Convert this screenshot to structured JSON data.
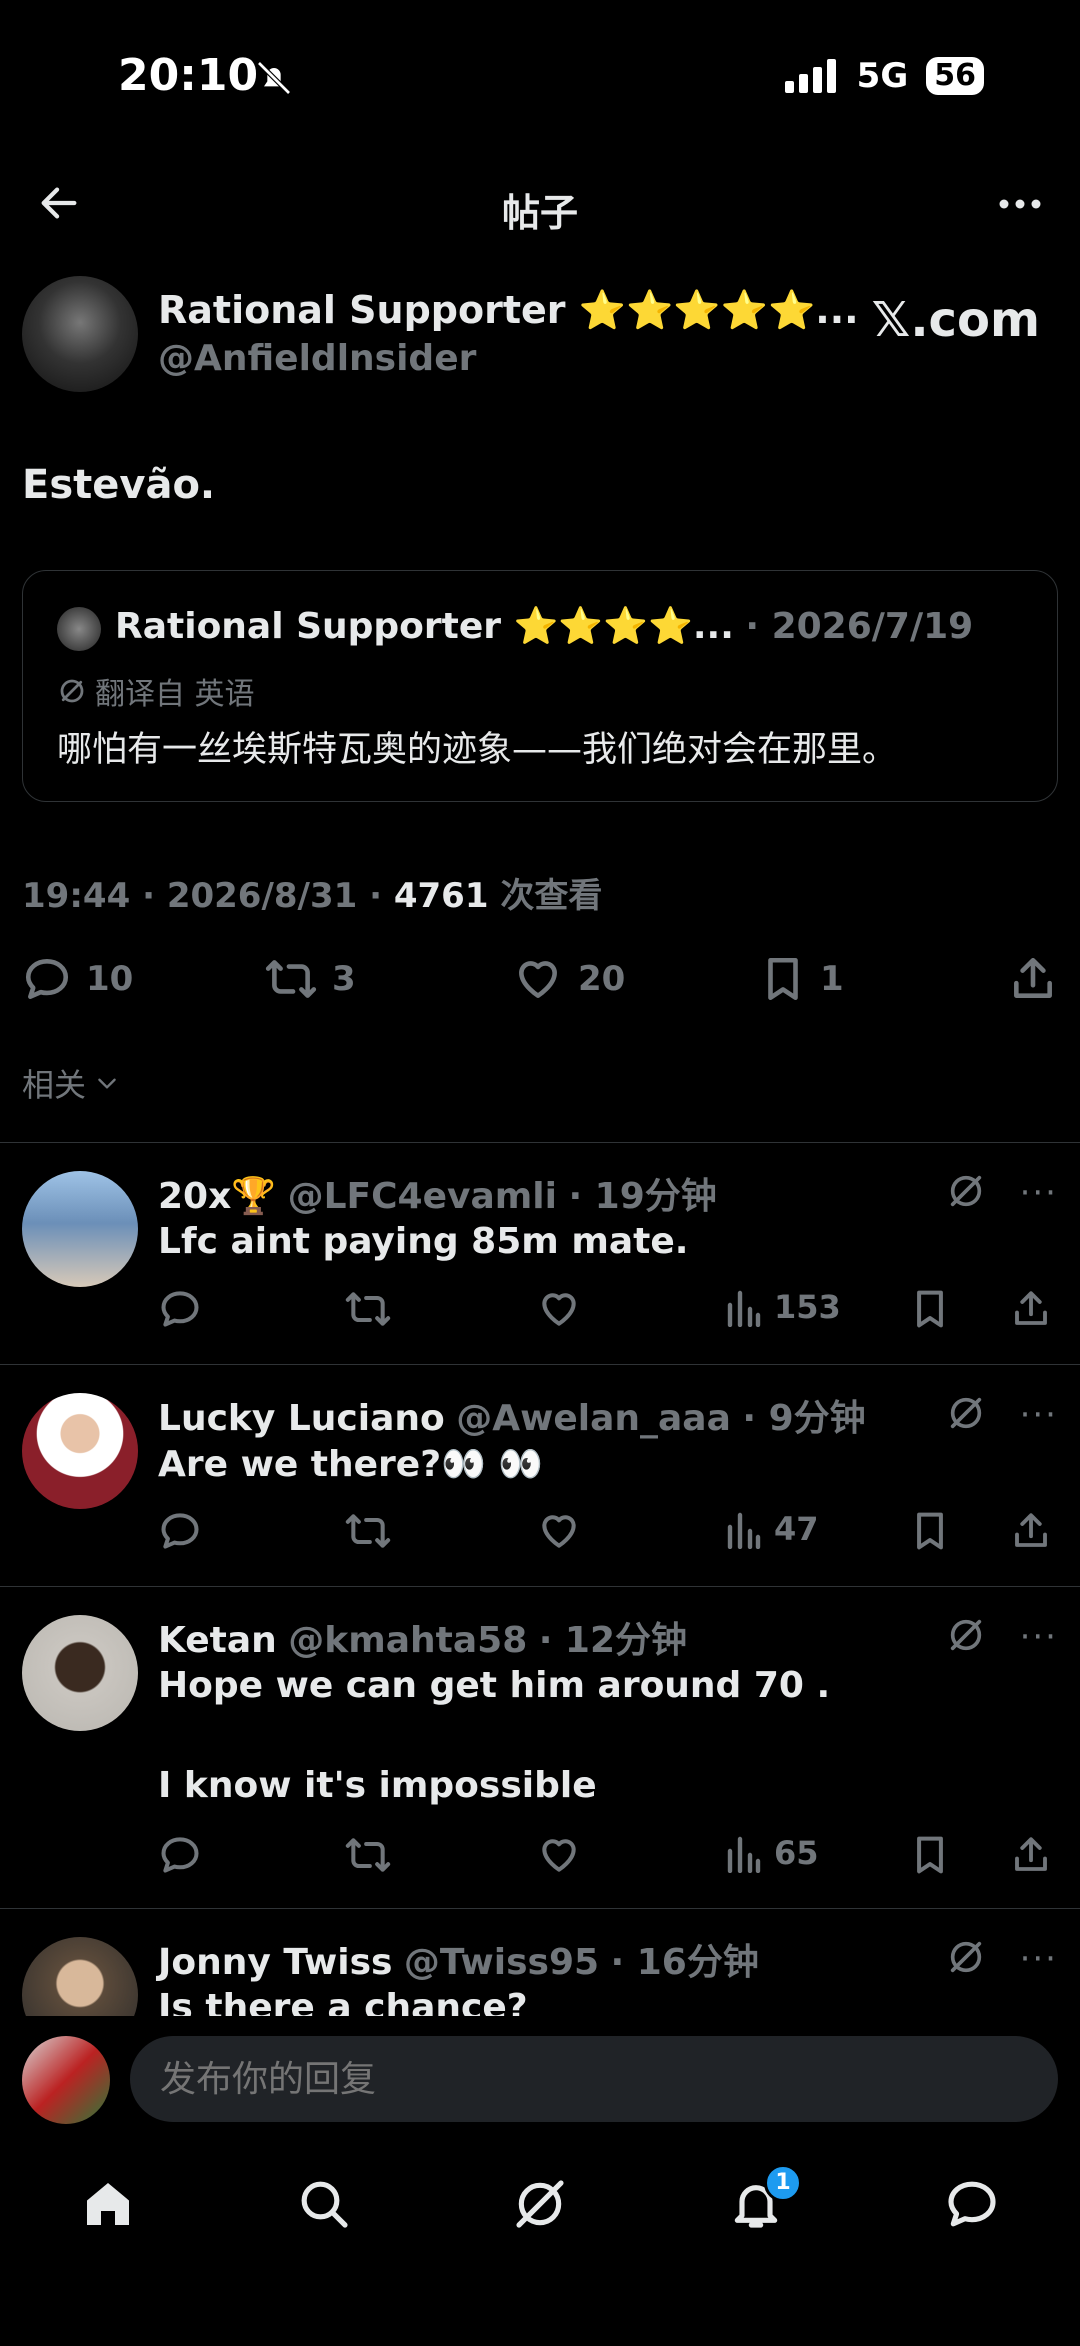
{
  "status": {
    "time": "20:10",
    "network": "5G",
    "battery": "56"
  },
  "header": {
    "title": "帖子"
  },
  "post": {
    "author_name": "Rational Supporter ⭐⭐⭐⭐⭐...",
    "author_handle": "@Anfieldlnsider",
    "badge": "𝕏.com",
    "text": "Estevão.",
    "quote": {
      "author_name": "Rational Supporter ⭐⭐⭐⭐...",
      "date": "· 2026/7/19",
      "translated_label": "翻译自 英语",
      "text": "哪怕有一丝埃斯特瓦奥的迹象——我们绝对会在那里。"
    },
    "meta_time": "19:44 · 2026/8/31 · ",
    "views_count": "4761",
    "views_label": " 次查看",
    "replies": "10",
    "reposts": "3",
    "likes": "20",
    "bookmarks": "1"
  },
  "related_label": "相关",
  "replies": [
    {
      "name": "20x🏆",
      "handle": "@LFC4evamli",
      "time": "· 19分钟",
      "text": "Lfc aint paying 85m mate.",
      "text2": "",
      "views": "153",
      "avatar_color": "#6b8fb8"
    },
    {
      "name": "Lucky Luciano",
      "handle": "@Awelan_aaa",
      "time": "· 9分钟",
      "text": "Are we there?👀 👀",
      "text2": "",
      "views": "47",
      "avatar_color": "#8a1f2a"
    },
    {
      "name": "Ketan",
      "handle": "@kmahta58",
      "time": "· 12分钟",
      "text": "Hope we can get him around 70 .",
      "text2": "I know it's impossible",
      "views": "65",
      "avatar_color": "#b9b6b0"
    },
    {
      "name": "Jonny Twiss",
      "handle": "@Twiss95",
      "time": "· 16分钟",
      "text": "Is there a chance?",
      "text2": "",
      "views": "",
      "avatar_color": "#5b4a3a"
    }
  ],
  "reply_input": {
    "placeholder": "发布你的回复"
  },
  "tabbar": {
    "notifications_badge": "1"
  },
  "colors": {
    "background": "#000000",
    "text": "#e7e9ea",
    "muted": "#71767b",
    "accent": "#1d9bf0",
    "gold_star": "#f5c518"
  }
}
